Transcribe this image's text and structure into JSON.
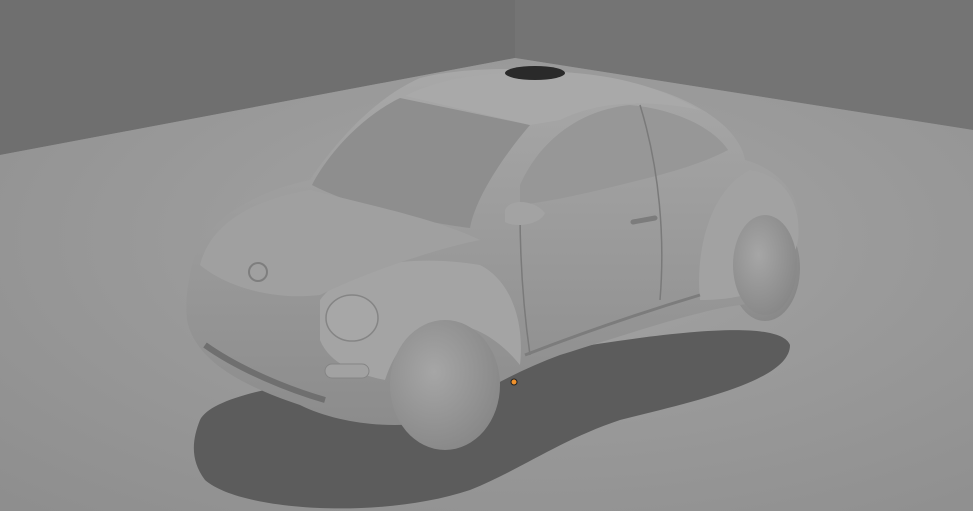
{
  "scene": {
    "subject": "car",
    "colors": {
      "wall_left": "#6f6f6f",
      "wall_right": "#727272",
      "floor": "#9c9c9c",
      "shadow": "#5a5a5a",
      "car_body": "#9a9a9a",
      "car_highlight": "#b0b0b0",
      "car_dark": "#7a7a7a",
      "origin_marker": "#f0922c"
    }
  }
}
